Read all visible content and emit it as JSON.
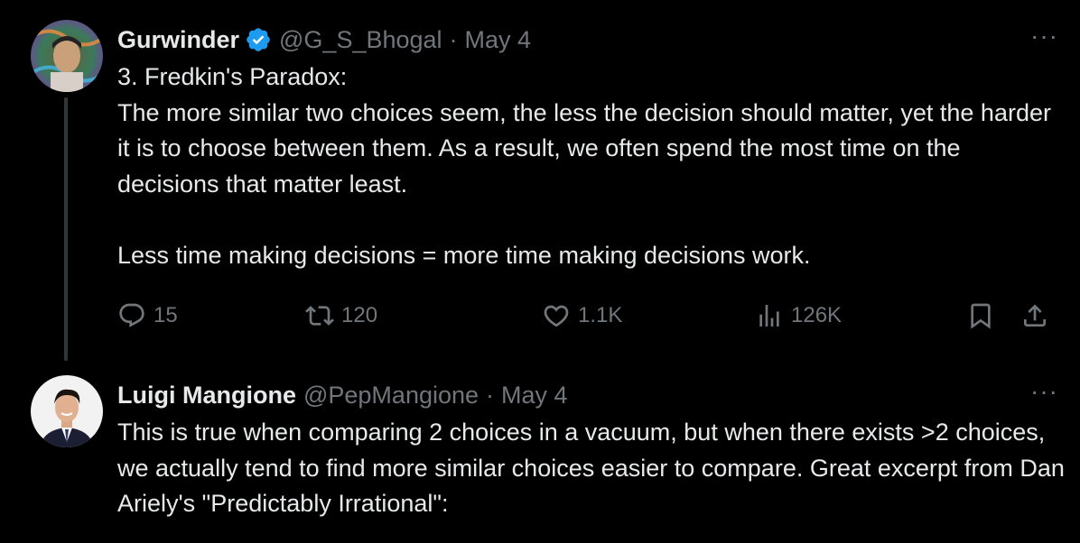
{
  "tweets": [
    {
      "name": "Gurwinder",
      "verified": true,
      "handle": "@G_S_Bhogal",
      "separator": "·",
      "date": "May 4",
      "more": "···",
      "paragraphs": [
        "3. Fredkin's Paradox:",
        "The more similar two choices seem, the less the decision should matter, yet the harder it is to choose between them. As a result, we often spend the most time on the decisions that matter least.",
        "",
        "Less time making decisions = more time making decisions work."
      ],
      "stats": {
        "replies": "15",
        "retweets": "120",
        "likes": "1.1K",
        "views": "126K"
      }
    },
    {
      "name": "Luigi Mangione",
      "verified": false,
      "handle": "@PepMangione",
      "separator": "·",
      "date": "May 4",
      "more": "···",
      "paragraphs": [
        "This is true when comparing 2 choices in a vacuum, but when there exists >2 choices, we actually tend to find more similar choices easier to compare. Great excerpt from Dan Ariely's \"Predictably Irrational\":"
      ]
    }
  ],
  "colors": {
    "background": "#000000",
    "text": "#e7e9ea",
    "secondary": "#71767b",
    "verified": "#1d9bf0",
    "thread_line": "#333639"
  },
  "icons": [
    "reply-icon",
    "retweet-icon",
    "like-icon",
    "views-icon",
    "bookmark-icon",
    "share-icon",
    "verified-badge-icon",
    "more-icon"
  ]
}
